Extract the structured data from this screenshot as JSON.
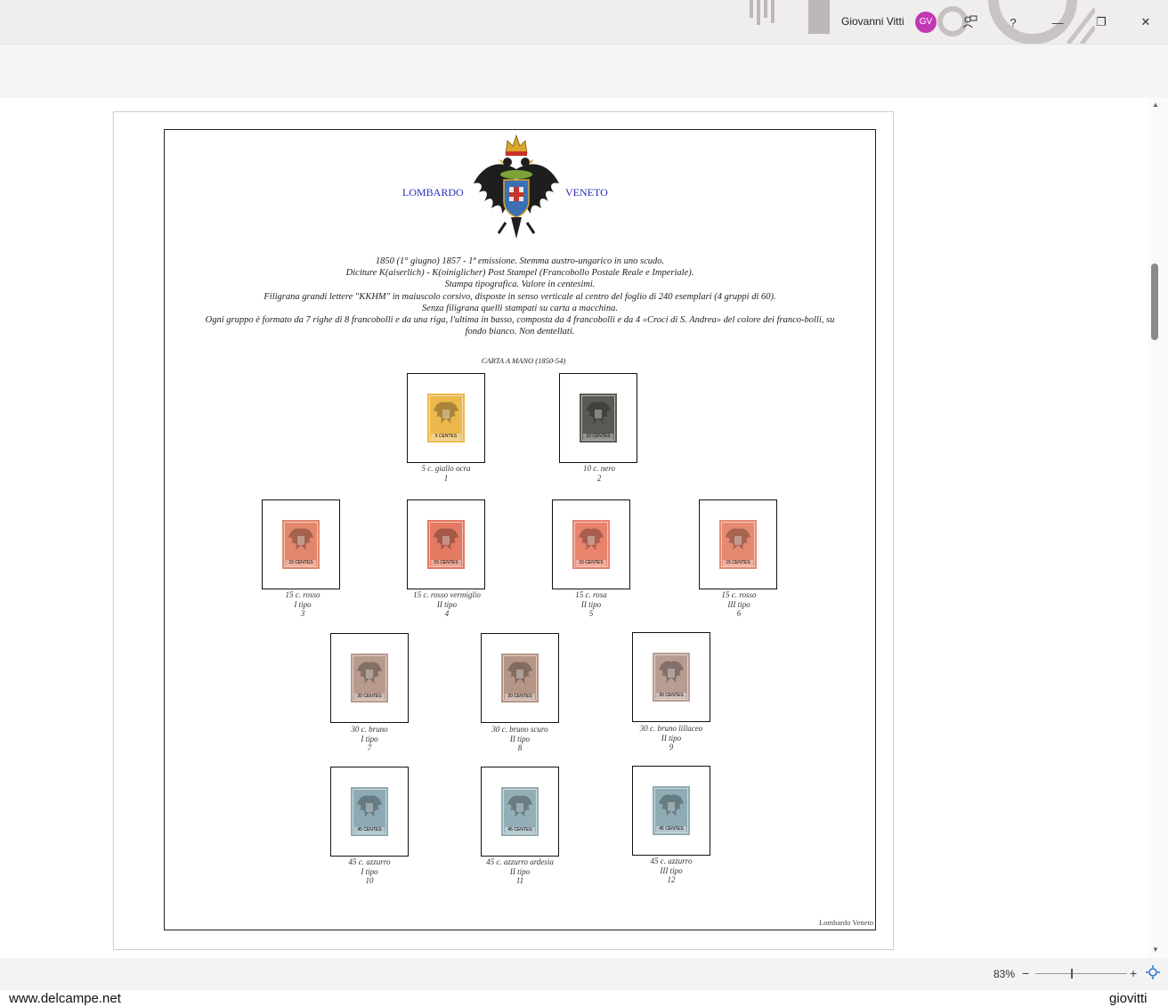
{
  "titlebar": {
    "user_name": "Giovanni Vitti",
    "avatar_initials": "GV",
    "help_label": "?",
    "minimize_label": "—",
    "restore_label": "❐",
    "close_label": "✕"
  },
  "page": {
    "region_left": "LOMBARDO",
    "region_right": "VENETO",
    "description": [
      "1850 (1° giugno) 1857 - 1ª emissione. Stemma austro-ungarico in uno scudo.",
      "Diciture K(aiserlich) - K(oiniglicher) Post Stampel (Francobollo Postale Reale e Imperiale).",
      "Stampa tipografica. Valore in centesimi.",
      "Filigrana grandi lettere \"KKHM\" in maiuscolo corsivo, disposte in senso verticale al centro del foglio di 240 esemplari (4 gruppi di 60).",
      "Senza filigrana quelli stampati su carta a macchina.",
      "Ogni gruppo è formato da 7 righe di 8 francobolli e da una riga, l'ultima in basso, composta da 4 francobolli e da 4 «Croci di S. Andrea» del colore dei franco-bolli, su",
      "fondo bianco. Non dentellati."
    ],
    "section_title": "CARTA A MANO (1850-54)",
    "footer": "Lombardo Veneto"
  },
  "stamps": [
    {
      "desc": "5 c. giallo ocra",
      "tipo": "",
      "num": "1",
      "color": "#ecb84e",
      "value_text": "5 CENTES"
    },
    {
      "desc": "10 c. nero",
      "tipo": "",
      "num": "2",
      "color": "#5a5a55",
      "value_text": "10 CENTES"
    },
    {
      "desc": "15 c. rosso",
      "tipo": "I tipo",
      "num": "3",
      "color": "#e2876c",
      "value_text": "15 CENTES"
    },
    {
      "desc": "15 c. rosso vermiglio",
      "tipo": "II tipo",
      "num": "4",
      "color": "#e37a62",
      "value_text": "15 CENTES"
    },
    {
      "desc": "15 c. rosa",
      "tipo": "II tipo",
      "num": "5",
      "color": "#e9836c",
      "value_text": "15 CENTES"
    },
    {
      "desc": "15 c. rosso",
      "tipo": "III tipo",
      "num": "6",
      "color": "#e58a70",
      "value_text": "15 CENTES"
    },
    {
      "desc": "30 c. bruno",
      "tipo": "I tipo",
      "num": "7",
      "color": "#b89a8c",
      "value_text": "30 CENTES"
    },
    {
      "desc": "30 c. bruno scuro",
      "tipo": "II tipo",
      "num": "8",
      "color": "#b59585",
      "value_text": "30 CENTES"
    },
    {
      "desc": "30 c. bruno lillaceo",
      "tipo": "II tipo",
      "num": "9",
      "color": "#b89c91",
      "value_text": "30 CENTES"
    },
    {
      "desc": "45 c. azzurro",
      "tipo": "I tipo",
      "num": "10",
      "color": "#8daab4",
      "value_text": "45 CENTES"
    },
    {
      "desc": "45 c. azzurro ardesia",
      "tipo": "II tipo",
      "num": "11",
      "color": "#92aeb7",
      "value_text": "45 CENTES"
    },
    {
      "desc": "45 c. azzurro",
      "tipo": "III tipo",
      "num": "12",
      "color": "#8fabb4",
      "value_text": "45 CENTES"
    }
  ],
  "statusbar": {
    "zoom": "83%",
    "zoom_out": "−",
    "zoom_in": "+"
  },
  "watermark": {
    "left": "www.delcampe.net",
    "right": "giovitti"
  }
}
